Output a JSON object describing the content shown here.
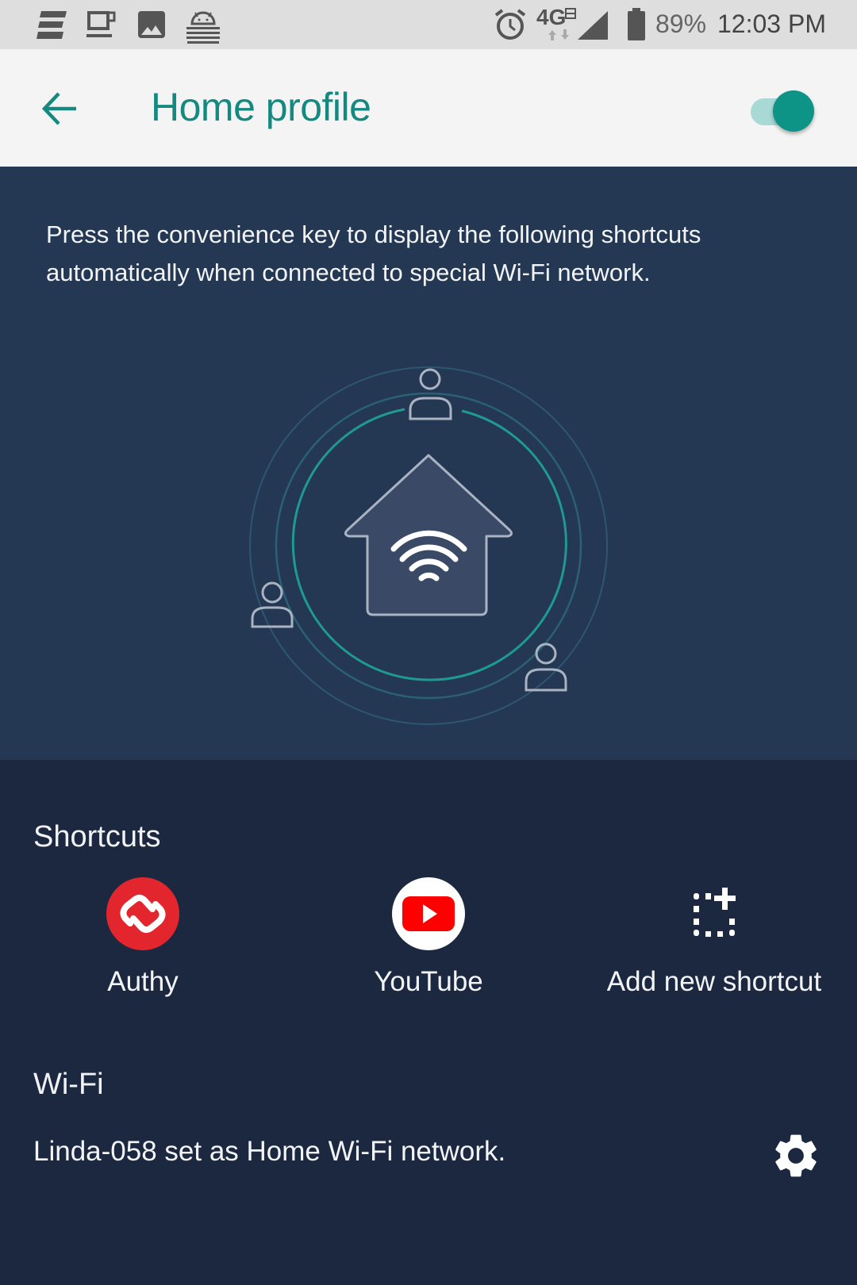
{
  "status_bar": {
    "left_icons": [
      "espn-icon",
      "coffee-cup-icon",
      "gallery-icon",
      "android-keystore-icon"
    ],
    "right_icons": [
      "alarm-icon",
      "4g-lte-icon",
      "signal-icon",
      "battery-icon"
    ],
    "network": "4G",
    "battery": "89%",
    "time": "12:03 PM"
  },
  "app_bar": {
    "back_icon": "arrow-left-icon",
    "title": "Home profile",
    "toggle_on": true
  },
  "colors": {
    "accent": "#15897f",
    "toggle_knob": "#0e9486",
    "toggle_track": "#a8d9d5",
    "hero_bg": "#243753",
    "page_bg": "#1b2840",
    "authy_red": "#e3262e",
    "youtube_red": "#ff0000"
  },
  "hero": {
    "description": "Press the convenience key to display the following shortcuts automatically when connected to special Wi-Fi network.",
    "illustration": "home-wifi-users-illustration"
  },
  "shortcuts": {
    "title": "Shortcuts",
    "items": [
      {
        "label": "Authy",
        "icon": "authy-icon"
      },
      {
        "label": "YouTube",
        "icon": "youtube-icon"
      },
      {
        "label": "Add new shortcut",
        "icon": "add-shortcut-icon"
      }
    ]
  },
  "wifi": {
    "title": "Wi-Fi",
    "status": "Linda-058 set as Home Wi-Fi network.",
    "settings_icon": "gear-icon"
  }
}
